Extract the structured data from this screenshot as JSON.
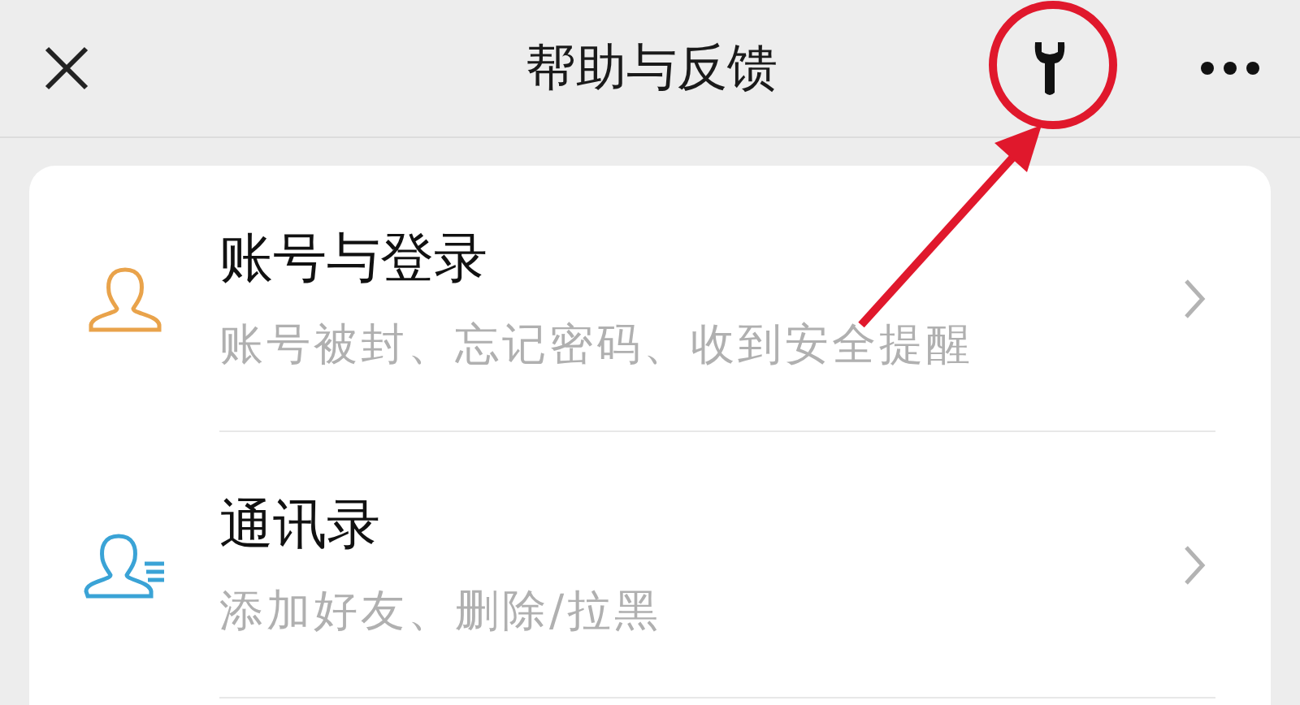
{
  "header": {
    "title": "帮助与反馈"
  },
  "items": [
    {
      "kind": "account",
      "title": "账号与登录",
      "subtitle": "账号被封、忘记密码、收到安全提醒"
    },
    {
      "kind": "contacts",
      "title": "通讯录",
      "subtitle": "添加好友、删除/拉黑"
    }
  ]
}
